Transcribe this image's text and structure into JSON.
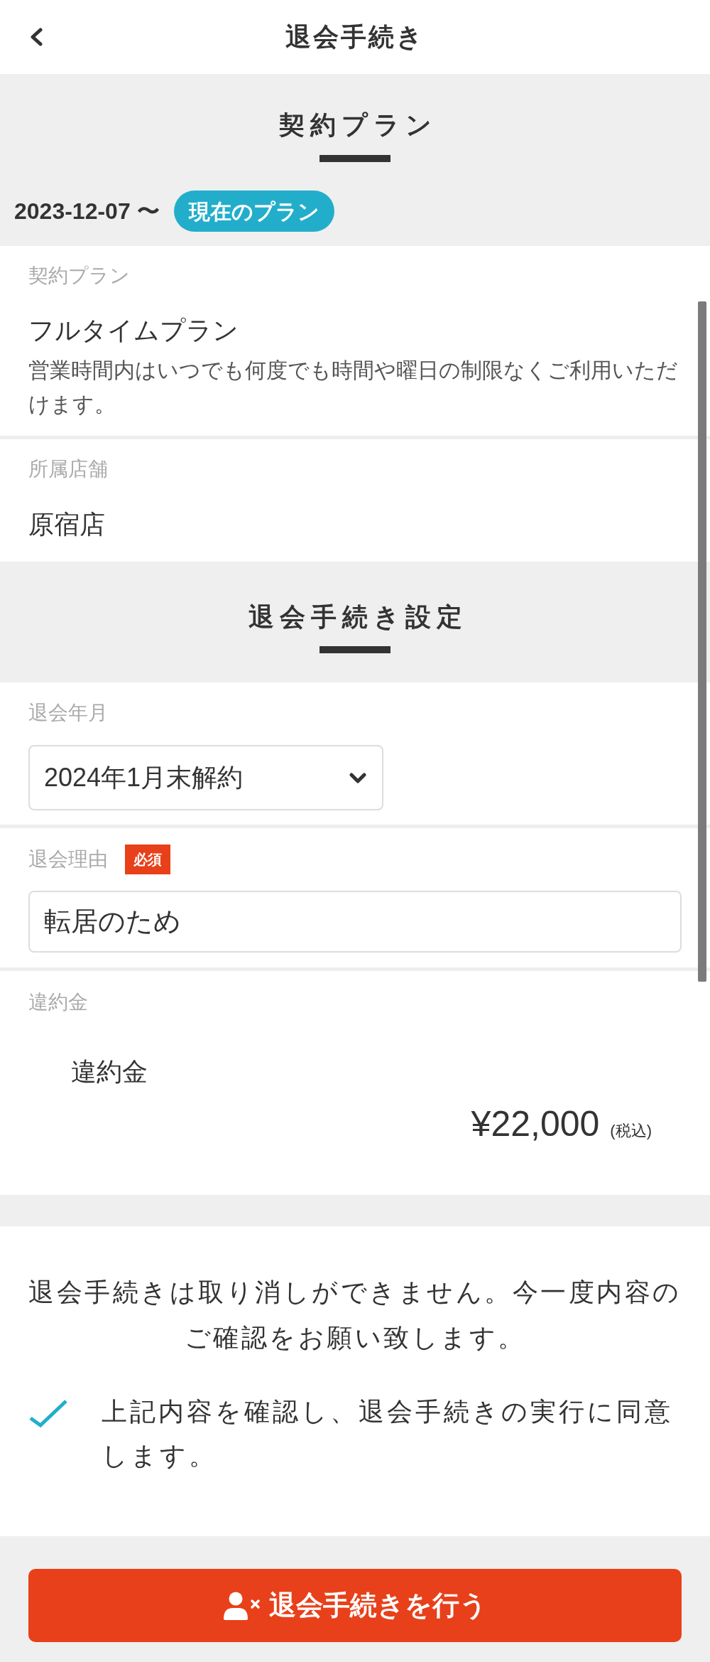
{
  "header": {
    "title": "退会手続き"
  },
  "contract_section": {
    "heading": "契約プラン",
    "period": "2023-12-07 〜",
    "badge": "現在のプラン",
    "fields": [
      {
        "label": "契約プラン",
        "value": "フルタイムプラン",
        "description": "営業時間内はいつでも何度でも時間や曜日の制限なくご利用いただけます。"
      },
      {
        "label": "所属店舗",
        "value": "原宿店"
      }
    ]
  },
  "cancellation_section": {
    "heading": "退会手続き設定",
    "fields": [
      {
        "kind": "select",
        "label": "退会年月",
        "value": "2024年1月末解約"
      },
      {
        "kind": "input",
        "label": "退会理由",
        "required_badge": "必須",
        "value": "転居のため"
      },
      {
        "kind": "fee",
        "label": "違約金",
        "item": "違約金",
        "amount": "¥22,000",
        "tax_note": "(税込)"
      }
    ]
  },
  "notice": "退会手続きは取り消しができません。今一度内容のご確認をお願い致します。",
  "agreement": {
    "checked": true,
    "label": "上記内容を確認し、退会手続きの実行に同意します。"
  },
  "submit_button": {
    "label": "退会手続きを行う"
  }
}
